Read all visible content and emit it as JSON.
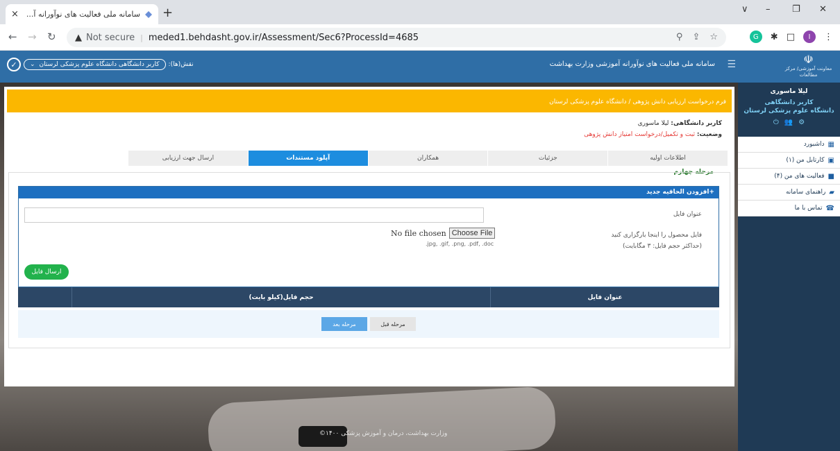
{
  "browser": {
    "tab_title": "سامانه ملی فعالیت های نوآورانه آ...",
    "new_tab": "+",
    "close": "×",
    "not_secure": "Not secure",
    "url": "meded1.behdasht.gov.ir/Assessment/Sec6?ProcessId=4685",
    "profile_letter": "I",
    "ext_letter": "G",
    "win_min": "–",
    "win_restore": "❐",
    "win_close": "✕",
    "tab_search": "∨"
  },
  "header": {
    "logo_sub": "معاونت آموزشی/ مرکز مطالعات",
    "site_title": "سامانه ملی فعالیت های نوآورانه آموزشی وزارت بهداشت",
    "role_label": "نقش(ها):",
    "role_value": "کاربر دانشگاهی دانشگاه علوم پزشکی لرستان"
  },
  "sidebar": {
    "user_name": "لیلا ماسوری",
    "user_role": "کاربر دانشگاهی",
    "user_uni": "دانشگاه علوم پزشکی لرستان",
    "items": [
      {
        "label": "داشبورد"
      },
      {
        "label": "کارتابل من (۱)"
      },
      {
        "label": "فعالیت های من (۴)"
      },
      {
        "label": "راهنمای سامانه"
      },
      {
        "label": "تماس با ما"
      }
    ]
  },
  "form": {
    "banner": "فرم درخواست ارزیابی دانش پژوهی / دانشگاه علوم پزشکی لرستان",
    "user_label": "کاربر دانشگاهی:",
    "user_value": "لیلا ماسوری",
    "status_label": "وضعیت:",
    "status_value": "ثبت و تکمیل/درخواست امتیاز دانش پژوهی",
    "steps": [
      {
        "label": "اطلاعات اولیه"
      },
      {
        "label": "جزئیات"
      },
      {
        "label": "همکاران"
      },
      {
        "label": "آپلود مستندات"
      },
      {
        "label": "ارسال جهت ارزیابی"
      }
    ],
    "stage_label": "مرحله چهارم",
    "add_header": "+افزودن الحاقیه جدید",
    "file_title_label": "عنوان فایل",
    "file_upload_label": "فایل محصول را اینجا بارگزاری کنید",
    "file_size_note": "(حداکثر حجم فایل: ۳ مگابایت)",
    "no_file": "No file chosen",
    "choose_file": "Choose File",
    "allowed_ext": ".jpg, .gif, .png, .pdf, .doc",
    "send_button": "ارسال فایل",
    "table_headers": [
      "عنوان فایل",
      "حجم فایل(کیلو بایت)",
      ""
    ],
    "prev_button": "مرحله قبل",
    "next_button": "مرحله بعد"
  },
  "footer": {
    "text": "وزارت بهداشت، درمان و آموزش پزشکی ۱۴۰۰©"
  }
}
